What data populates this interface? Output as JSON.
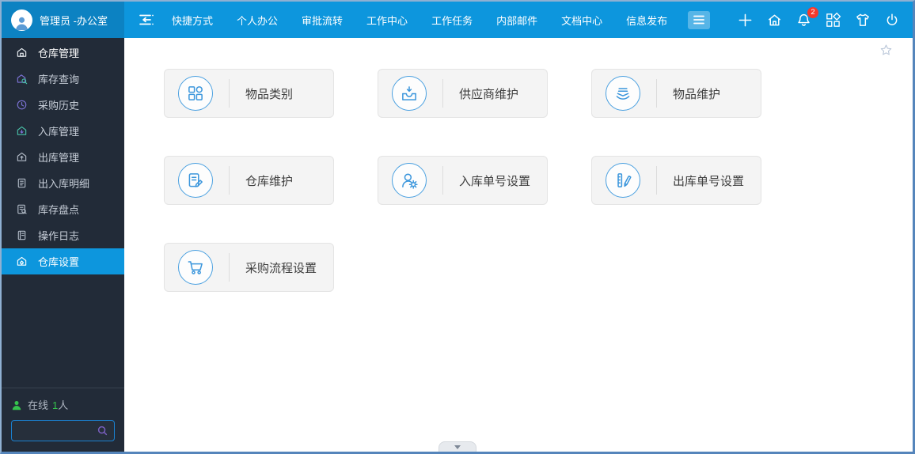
{
  "topbar": {
    "user_name": "管理员 -办公室",
    "nav_items": [
      "快捷方式",
      "个人办公",
      "审批流转",
      "工作中心",
      "工作任务",
      "内部邮件",
      "文档中心",
      "信息发布"
    ],
    "notification_badge": "2"
  },
  "sidebar": {
    "items": [
      {
        "label": "仓库管理",
        "icon": "warehouse-home-icon",
        "active": false
      },
      {
        "label": "库存查询",
        "icon": "inventory-search-icon",
        "active": false
      },
      {
        "label": "采购历史",
        "icon": "purchase-history-icon",
        "active": false
      },
      {
        "label": "入库管理",
        "icon": "inbound-icon",
        "active": false
      },
      {
        "label": "出库管理",
        "icon": "outbound-icon",
        "active": false
      },
      {
        "label": "出入库明细",
        "icon": "inout-detail-icon",
        "active": false
      },
      {
        "label": "库存盘点",
        "icon": "stocktake-icon",
        "active": false
      },
      {
        "label": "操作日志",
        "icon": "operation-log-icon",
        "active": false
      },
      {
        "label": "仓库设置",
        "icon": "warehouse-settings-icon",
        "active": true
      }
    ],
    "online": {
      "label": "在线",
      "count": "1",
      "unit": "人"
    },
    "search": {
      "value": "",
      "placeholder": ""
    }
  },
  "main": {
    "cards": [
      {
        "label": "物品类别",
        "icon": "category-icon"
      },
      {
        "label": "供应商维护",
        "icon": "supplier-icon"
      },
      {
        "label": "物品维护",
        "icon": "goods-icon"
      },
      {
        "label": "仓库维护",
        "icon": "warehouse-edit-icon"
      },
      {
        "label": "入库单号设置",
        "icon": "inbound-number-icon"
      },
      {
        "label": "出库单号设置",
        "icon": "outbound-number-icon"
      },
      {
        "label": "采购流程设置",
        "icon": "purchase-flow-icon"
      }
    ]
  },
  "colors": {
    "topbar_blue": "#0d96dd",
    "user_area_blue": "#0c82c2",
    "sidebar_dark": "#222b38",
    "active_item_blue": "#0d96dd",
    "badge_red": "#f5392c",
    "online_green": "#35c24d",
    "card_icon_blue": "#4aa0e0",
    "card_background": "#f4f4f4"
  }
}
